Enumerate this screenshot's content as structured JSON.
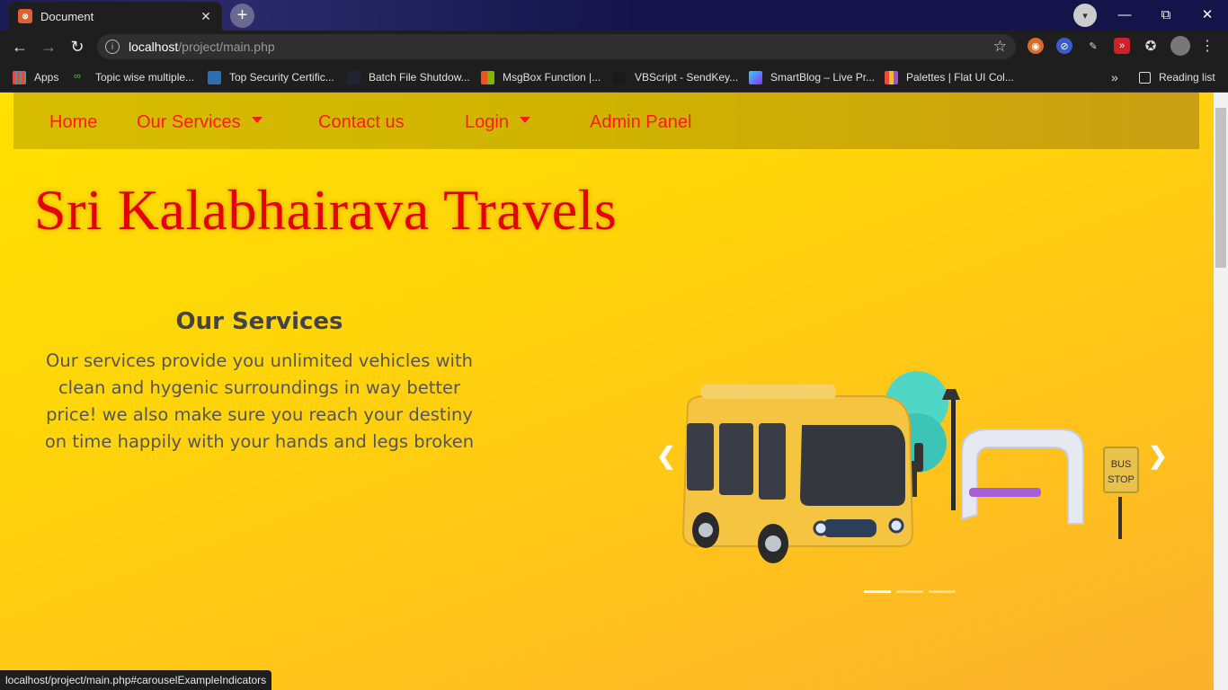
{
  "browser": {
    "tab_title": "Document",
    "tab_favicon": "xampp",
    "url_host": "localhost",
    "url_path": "/project/main.php",
    "bookmarks": [
      {
        "label": "Apps",
        "icon": "apps-grid-icon"
      },
      {
        "label": "Topic wise multiple...",
        "icon": "link-icon"
      },
      {
        "label": "Top Security Certific...",
        "icon": "doc-icon"
      },
      {
        "label": "Batch File Shutdow...",
        "icon": "file-icon"
      },
      {
        "label": "MsgBox Function |...",
        "icon": "windows-icon"
      },
      {
        "label": "VBScript - SendKey...",
        "icon": "script-icon"
      },
      {
        "label": "SmartBlog – Live Pr...",
        "icon": "blog-icon"
      },
      {
        "label": "Palettes | Flat UI Col...",
        "icon": "palette-icon"
      }
    ],
    "overflow_label": "»",
    "reading_list": "Reading list",
    "status_url": "localhost/project/main.php#carouselExampleIndicators"
  },
  "navbar": {
    "items": [
      {
        "label": "Home"
      },
      {
        "label": "Our Services"
      },
      {
        "label": "Contact us"
      },
      {
        "label": "Login"
      },
      {
        "label": "Admin Panel"
      }
    ]
  },
  "hero": {
    "brand": "Sri Kalabhairava Travels"
  },
  "services": {
    "heading": "Our Services",
    "body": "Our services provide you unlimited vehicles with clean and hygenic surroundings in way better price! we also make sure you reach your destiny on time happily with your hands and legs broken"
  },
  "carousel": {
    "sign_text_line1": "BUS",
    "sign_text_line2": "STOP",
    "slide_count": 3,
    "active_slide": 1
  },
  "colors": {
    "nav_text": "#ff1a1a",
    "brand_text": "#e60000",
    "page_bg": "#ffd50a"
  }
}
